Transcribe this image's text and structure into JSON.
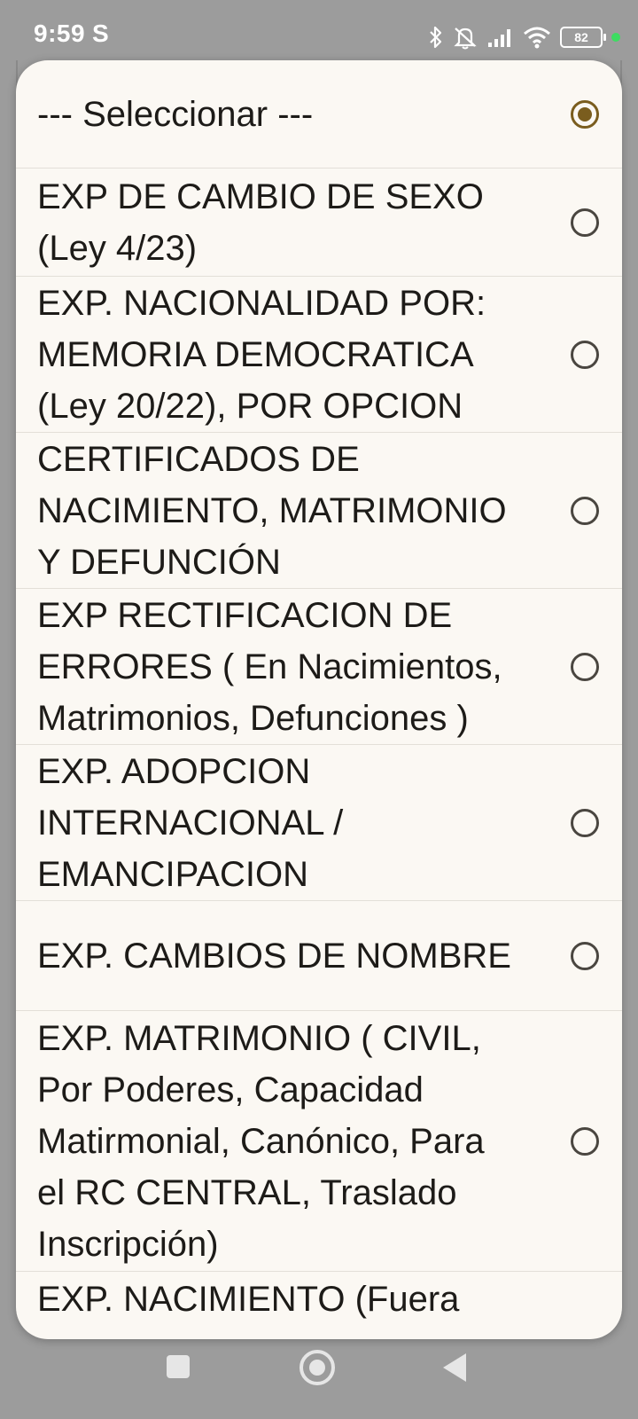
{
  "status_bar": {
    "time": "9:59",
    "app_indicator": "S",
    "battery": "82",
    "icons": [
      "bluetooth-icon",
      "mute-icon",
      "signal-icon",
      "wifi-icon",
      "battery-icon"
    ]
  },
  "dialog": {
    "selected_index": 0,
    "options": [
      {
        "label": "--- Seleccionar ---",
        "checked": true
      },
      {
        "label": "EXP DE CAMBIO DE SEXO\n(Ley 4/23)",
        "checked": false
      },
      {
        "label": "EXP. NACIONALIDAD POR:\nMEMORIA DEMOCRATICA\n(Ley 20/22), POR OPCION",
        "checked": false
      },
      {
        "label": "CERTIFICADOS DE\nNACIMIENTO, MATRIMONIO\nY DEFUNCIÓN",
        "checked": false
      },
      {
        "label": "EXP RECTIFICACION DE\nERRORES ( En Nacimientos,\nMatrimonios, Defunciones )",
        "checked": false
      },
      {
        "label": "EXP. ADOPCION\nINTERNACIONAL /\nEMANCIPACION",
        "checked": false
      },
      {
        "label": "EXP. CAMBIOS DE NOMBRE",
        "checked": false
      },
      {
        "label": "EXP. MATRIMONIO ( CIVIL,\nPor Poderes, Capacidad\nMatirmonial, Canónico, Para\nel RC CENTRAL, Traslado\nInscripción)",
        "checked": false
      },
      {
        "label": "EXP. NACIMIENTO (Fuera",
        "checked": false
      }
    ]
  },
  "nav_bar": {
    "buttons": [
      "recents-icon",
      "home-icon",
      "back-icon"
    ]
  },
  "colors": {
    "dialog_background": "#fbf8f3",
    "radio_selected": "#7a5d1e",
    "text": "#1d1b18",
    "status_dot": "#3ddc61"
  }
}
